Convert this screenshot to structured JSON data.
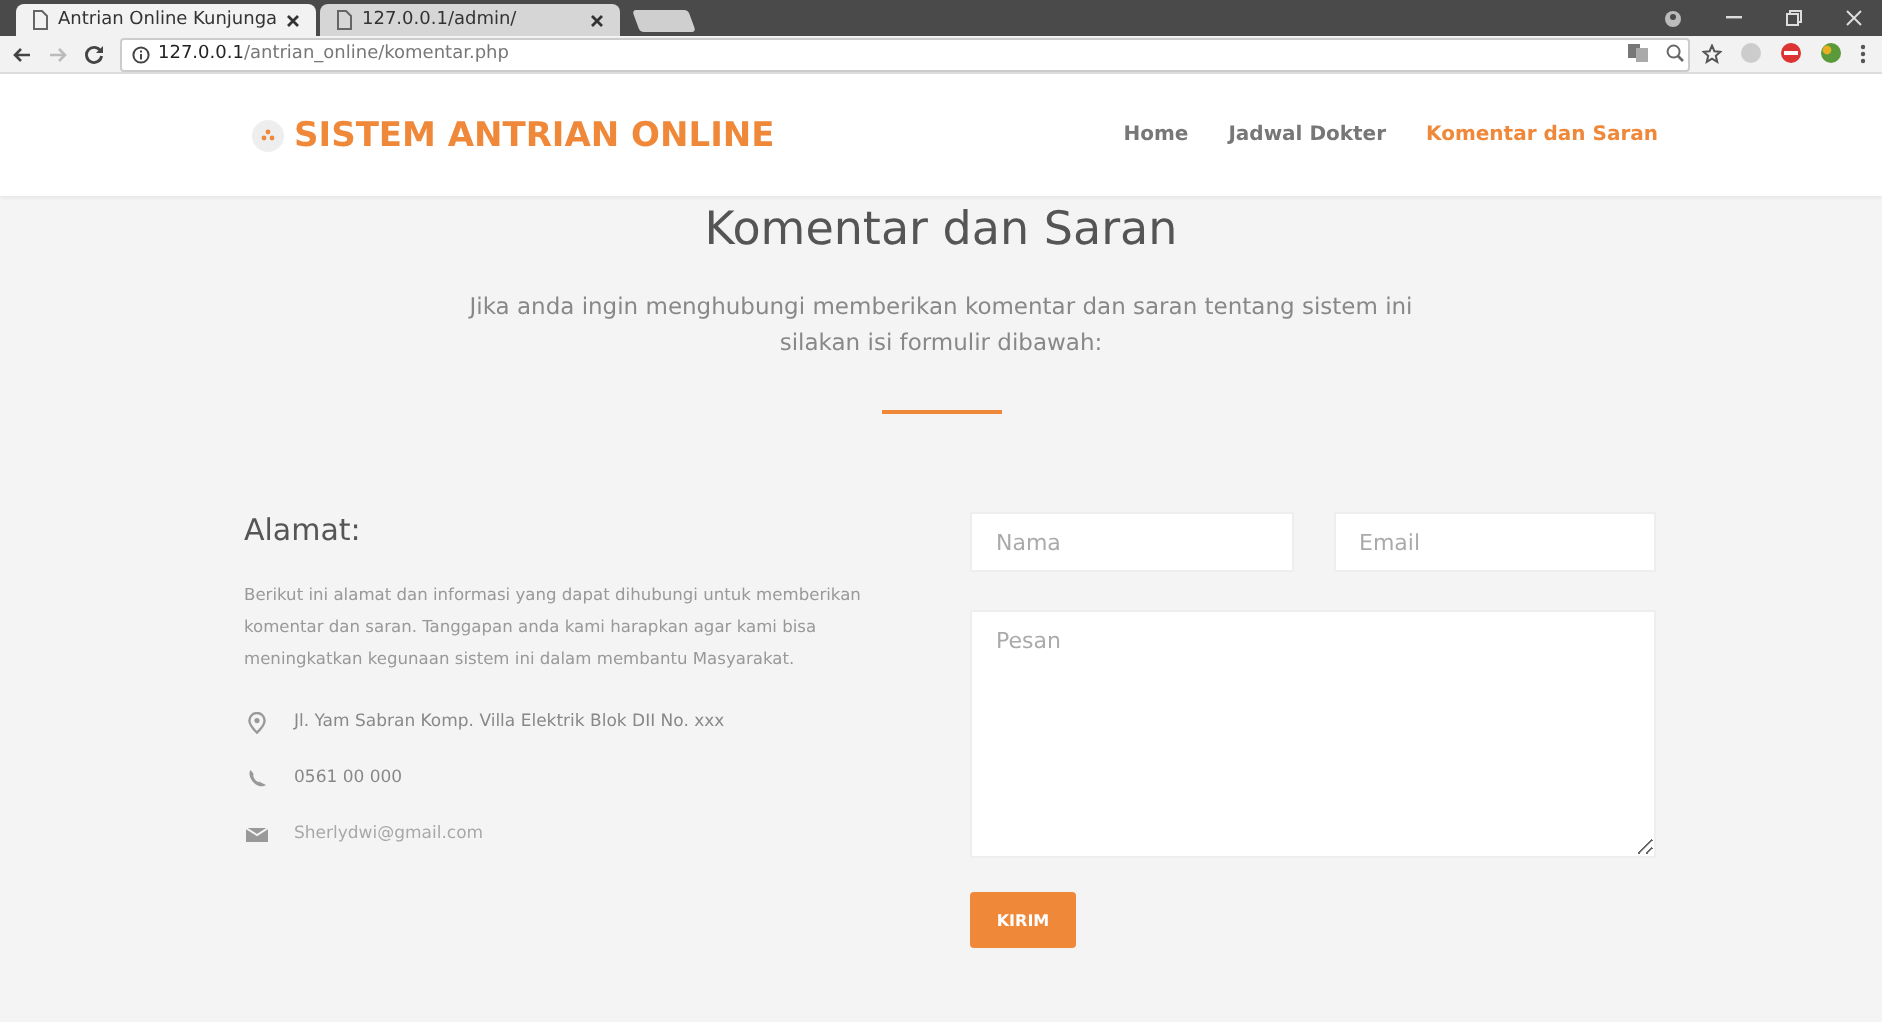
{
  "browser": {
    "tabs": [
      {
        "title": "Antrian Online Kunjunga",
        "selected": true
      },
      {
        "title": "127.0.0.1/admin/",
        "selected": false
      }
    ],
    "address": {
      "host": "127.0.0.1",
      "path": "/antrian_online/komentar.php"
    }
  },
  "site": {
    "brand": "SISTEM ANTRIAN ONLINE",
    "nav": [
      {
        "label": "Home",
        "selected": false
      },
      {
        "label": "Jadwal Dokter",
        "selected": false
      },
      {
        "label": "Komentar dan Saran",
        "selected": true
      }
    ],
    "heading": "Komentar dan Saran",
    "intro": "Jika anda ingin menghubungi memberikan komentar dan saran tentang sistem ini silakan isi formulir dibawah:",
    "contact": {
      "title": "Alamat:",
      "description": "Berikut ini alamat dan informasi yang dapat dihubungi untuk memberikan komentar dan saran. Tanggapan anda kami harapkan agar kami bisa meningkatkan kegunaan sistem ini dalam membantu Masyarakat.",
      "items": [
        {
          "kind": "address",
          "text": "Jl. Yam Sabran Komp. Villa Elektrik Blok DII No. xxx"
        },
        {
          "kind": "phone",
          "text": "0561 00 000"
        },
        {
          "kind": "email",
          "text": "Sherlydwi@gmail.com"
        }
      ]
    },
    "form": {
      "fields": [
        {
          "kind": "name",
          "placeholder": "Nama"
        },
        {
          "kind": "email",
          "placeholder": "Email"
        },
        {
          "kind": "message",
          "placeholder": "Pesan"
        }
      ],
      "button": "KIRIM"
    }
  }
}
